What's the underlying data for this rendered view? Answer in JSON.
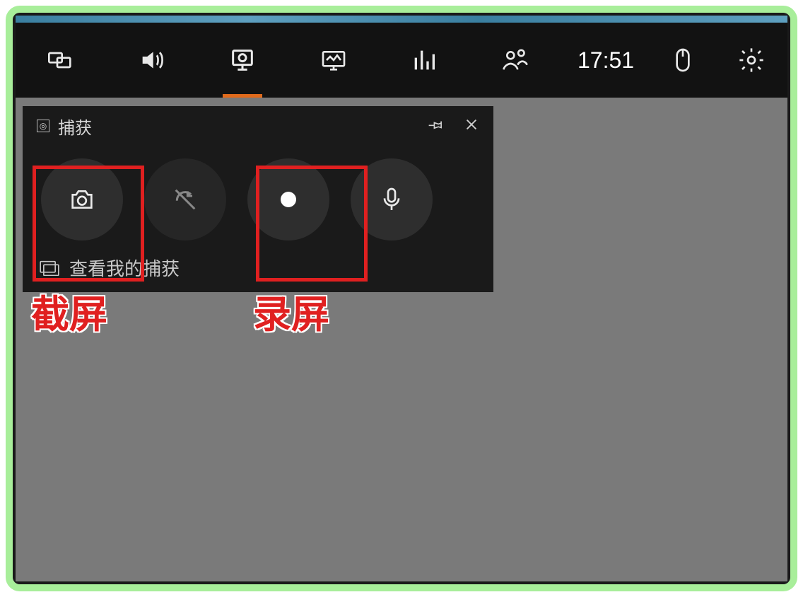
{
  "topbar": {
    "time": "17:51"
  },
  "panel": {
    "title": "捕获",
    "footer": "查看我的捕获"
  },
  "annotations": {
    "screenshot": "截屏",
    "record": "录屏"
  }
}
